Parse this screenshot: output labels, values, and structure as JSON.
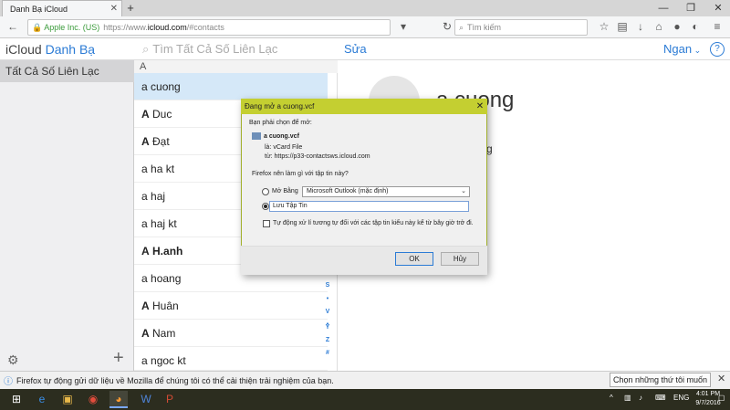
{
  "browser": {
    "tab_title": "Danh Bạ iCloud",
    "new_tab": "+",
    "url": {
      "org": "Apple Inc. (US)",
      "protocol": "https://www.",
      "host": "icloud.com",
      "path": "/#contacts"
    },
    "search_placeholder": "Tìm kiếm"
  },
  "app": {
    "brand": "iCloud",
    "name": "Danh Bạ",
    "search_placeholder": "Tìm Tất Cả Số Liên Lạc",
    "edit_label": "Sửa",
    "sort_label": "Ngan",
    "help_label": "?"
  },
  "sidebar": {
    "groups": [
      {
        "label": "Tất Cả Số Liên Lạc"
      }
    ]
  },
  "contacts": {
    "section": "A",
    "items": [
      {
        "first": "a",
        "last": "cuong"
      },
      {
        "first": "A",
        "last": "Duc"
      },
      {
        "first": "A",
        "last": "Đạt"
      },
      {
        "first": "a",
        "last": "ha kt"
      },
      {
        "first": "a",
        "last": "haj"
      },
      {
        "first": "a",
        "last": "haj kt"
      },
      {
        "first": "A",
        "last": "H.anh"
      },
      {
        "first": "a",
        "last": "hoang"
      },
      {
        "first": "A",
        "last": "Huân"
      },
      {
        "first": "A",
        "last": "Nam"
      },
      {
        "first": "a",
        "last": "ngoc kt"
      }
    ],
    "index_letters": [
      "S",
      "•",
      "V",
      "•",
      "Y",
      "Z",
      "#"
    ]
  },
  "detail": {
    "name": "a cuong",
    "subtitle": "g"
  },
  "dialog": {
    "title": "Đang mở a cuong.vcf",
    "prompt": "Bạn phải chọn để mở:",
    "file_name": "a cuong.vcf",
    "type_label": "là:",
    "type_value": "vCard File",
    "from_label": "từ:",
    "from_value": "https://p33-contactsws.icloud.com",
    "question": "Firefox nên làm gì với tập tin này?",
    "open_with_label": "Mở Bằng",
    "open_with_value": "Microsoft Outlook (mặc định)",
    "save_label": "Lưu Tập Tin",
    "auto_label": "Tự động xử lí tương tự đối với các tập tin kiểu này kể từ bây giờ trở đi.",
    "ok_label": "OK",
    "cancel_label": "Hủy"
  },
  "notification": {
    "text": "Firefox tự động gửi dữ liệu về Mozilla để chúng tôi có thể cải thiện trải nghiệm của bạn.",
    "button_label": "Chọn những thứ tôi muốn chia sẻ"
  },
  "taskbar": {
    "lang": "ENG",
    "time": "4:01 PM",
    "date": "9/7/2016"
  }
}
